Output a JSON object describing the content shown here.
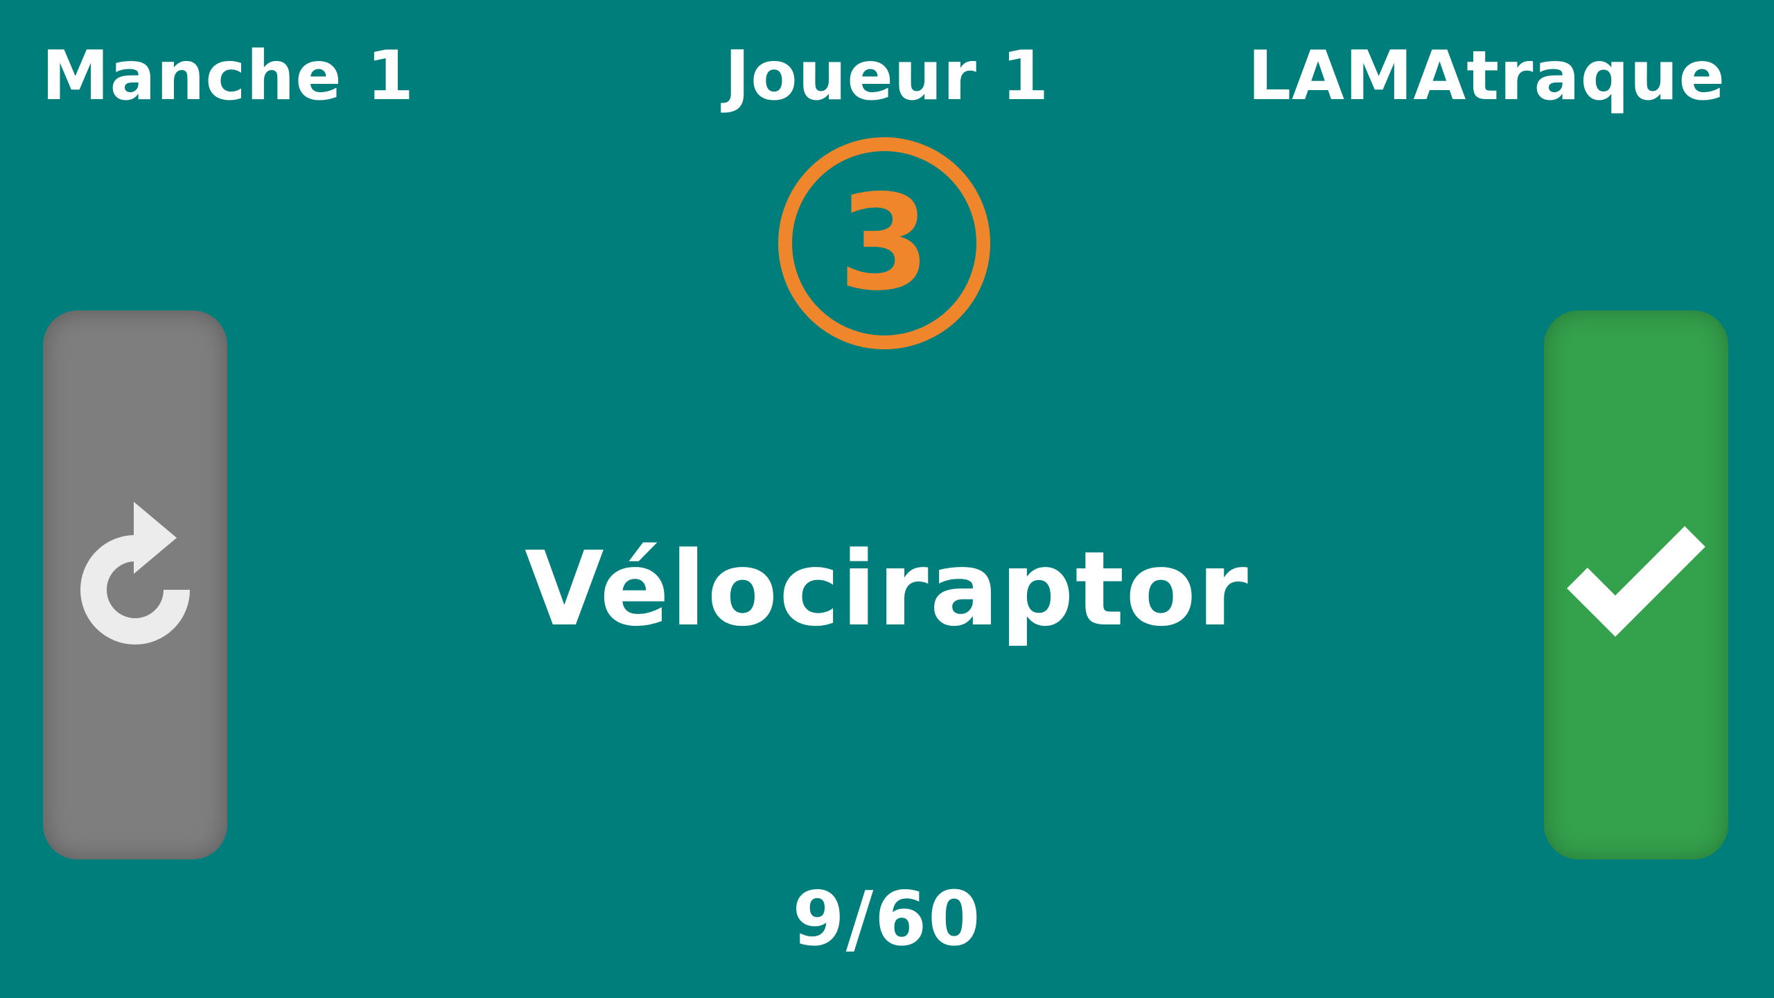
{
  "header": {
    "round_label": "Manche 1",
    "player_label": "Joueur 1",
    "game_title": "LAMAtraque"
  },
  "timer": {
    "value": "3"
  },
  "word": "Vélociraptor",
  "progress": "9/60",
  "buttons": {
    "skip_icon": "redo-arrow-icon",
    "validate_icon": "checkmark-icon"
  },
  "colors": {
    "background": "#007e7c",
    "timer": "#f0862b",
    "skip_button": "#7e7e7e",
    "validate_button": "#34a14c",
    "text": "#ffffff"
  }
}
